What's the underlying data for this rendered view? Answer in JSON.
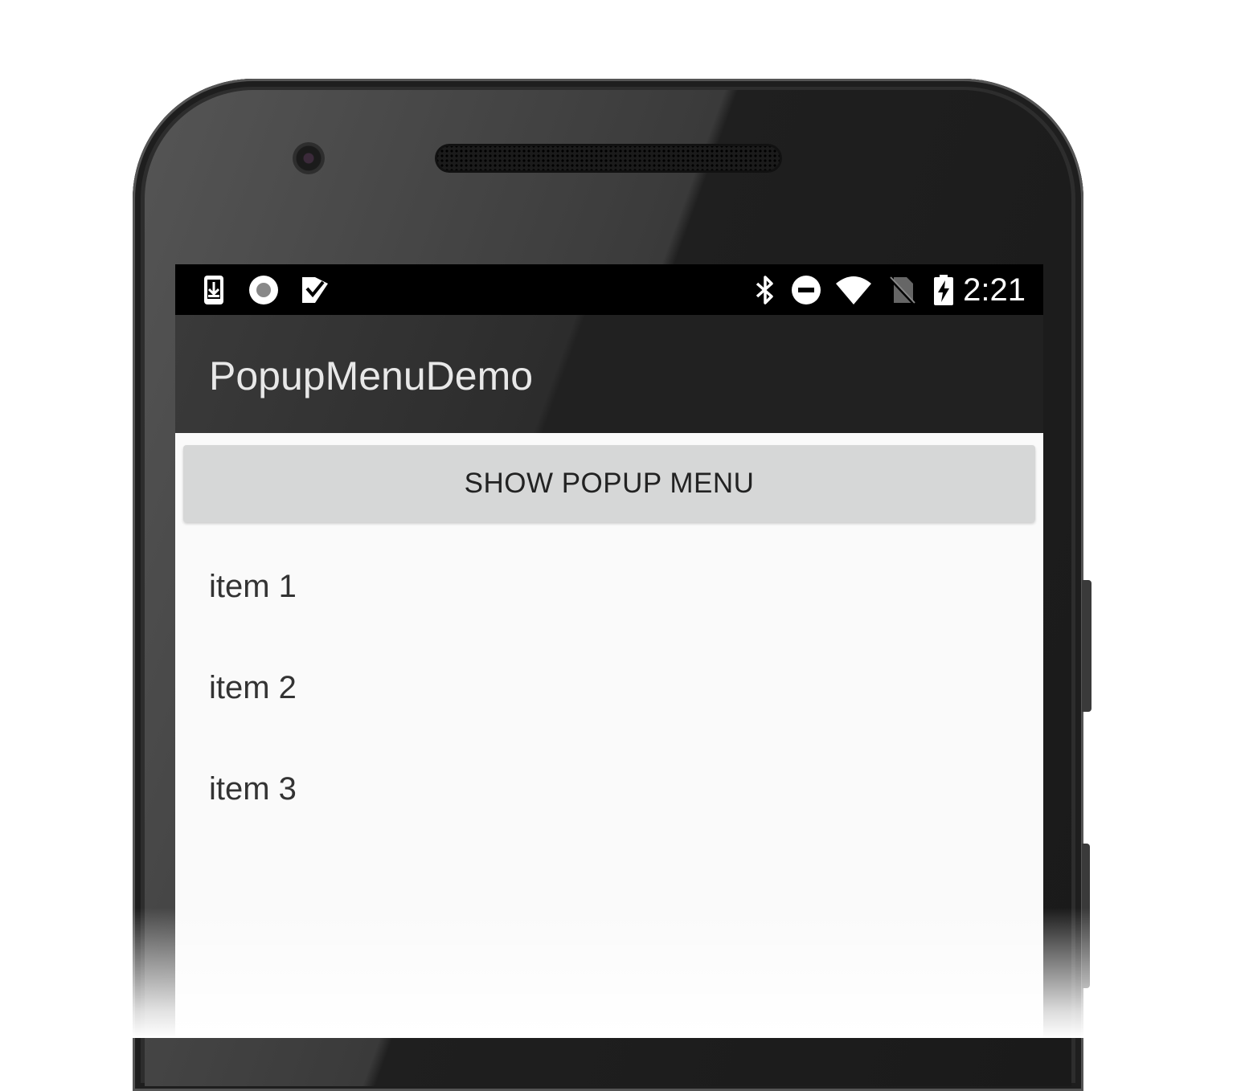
{
  "status_bar": {
    "left_icons": [
      "download-icon",
      "record-icon",
      "task-check-icon"
    ],
    "right_icons": [
      "bluetooth-icon",
      "do-not-disturb-icon",
      "wifi-icon",
      "no-sim-icon",
      "battery-charging-icon"
    ],
    "time": "2:21"
  },
  "app_bar": {
    "title": "PopupMenuDemo"
  },
  "main": {
    "button_label": "SHOW POPUP MENU",
    "items": [
      "item 1",
      "item 2",
      "item 3"
    ]
  },
  "colors": {
    "status_bar": "#000000",
    "app_bar": "#212121",
    "content_background": "#fafafa",
    "button": "#d6d7d7",
    "text": "#333333"
  }
}
